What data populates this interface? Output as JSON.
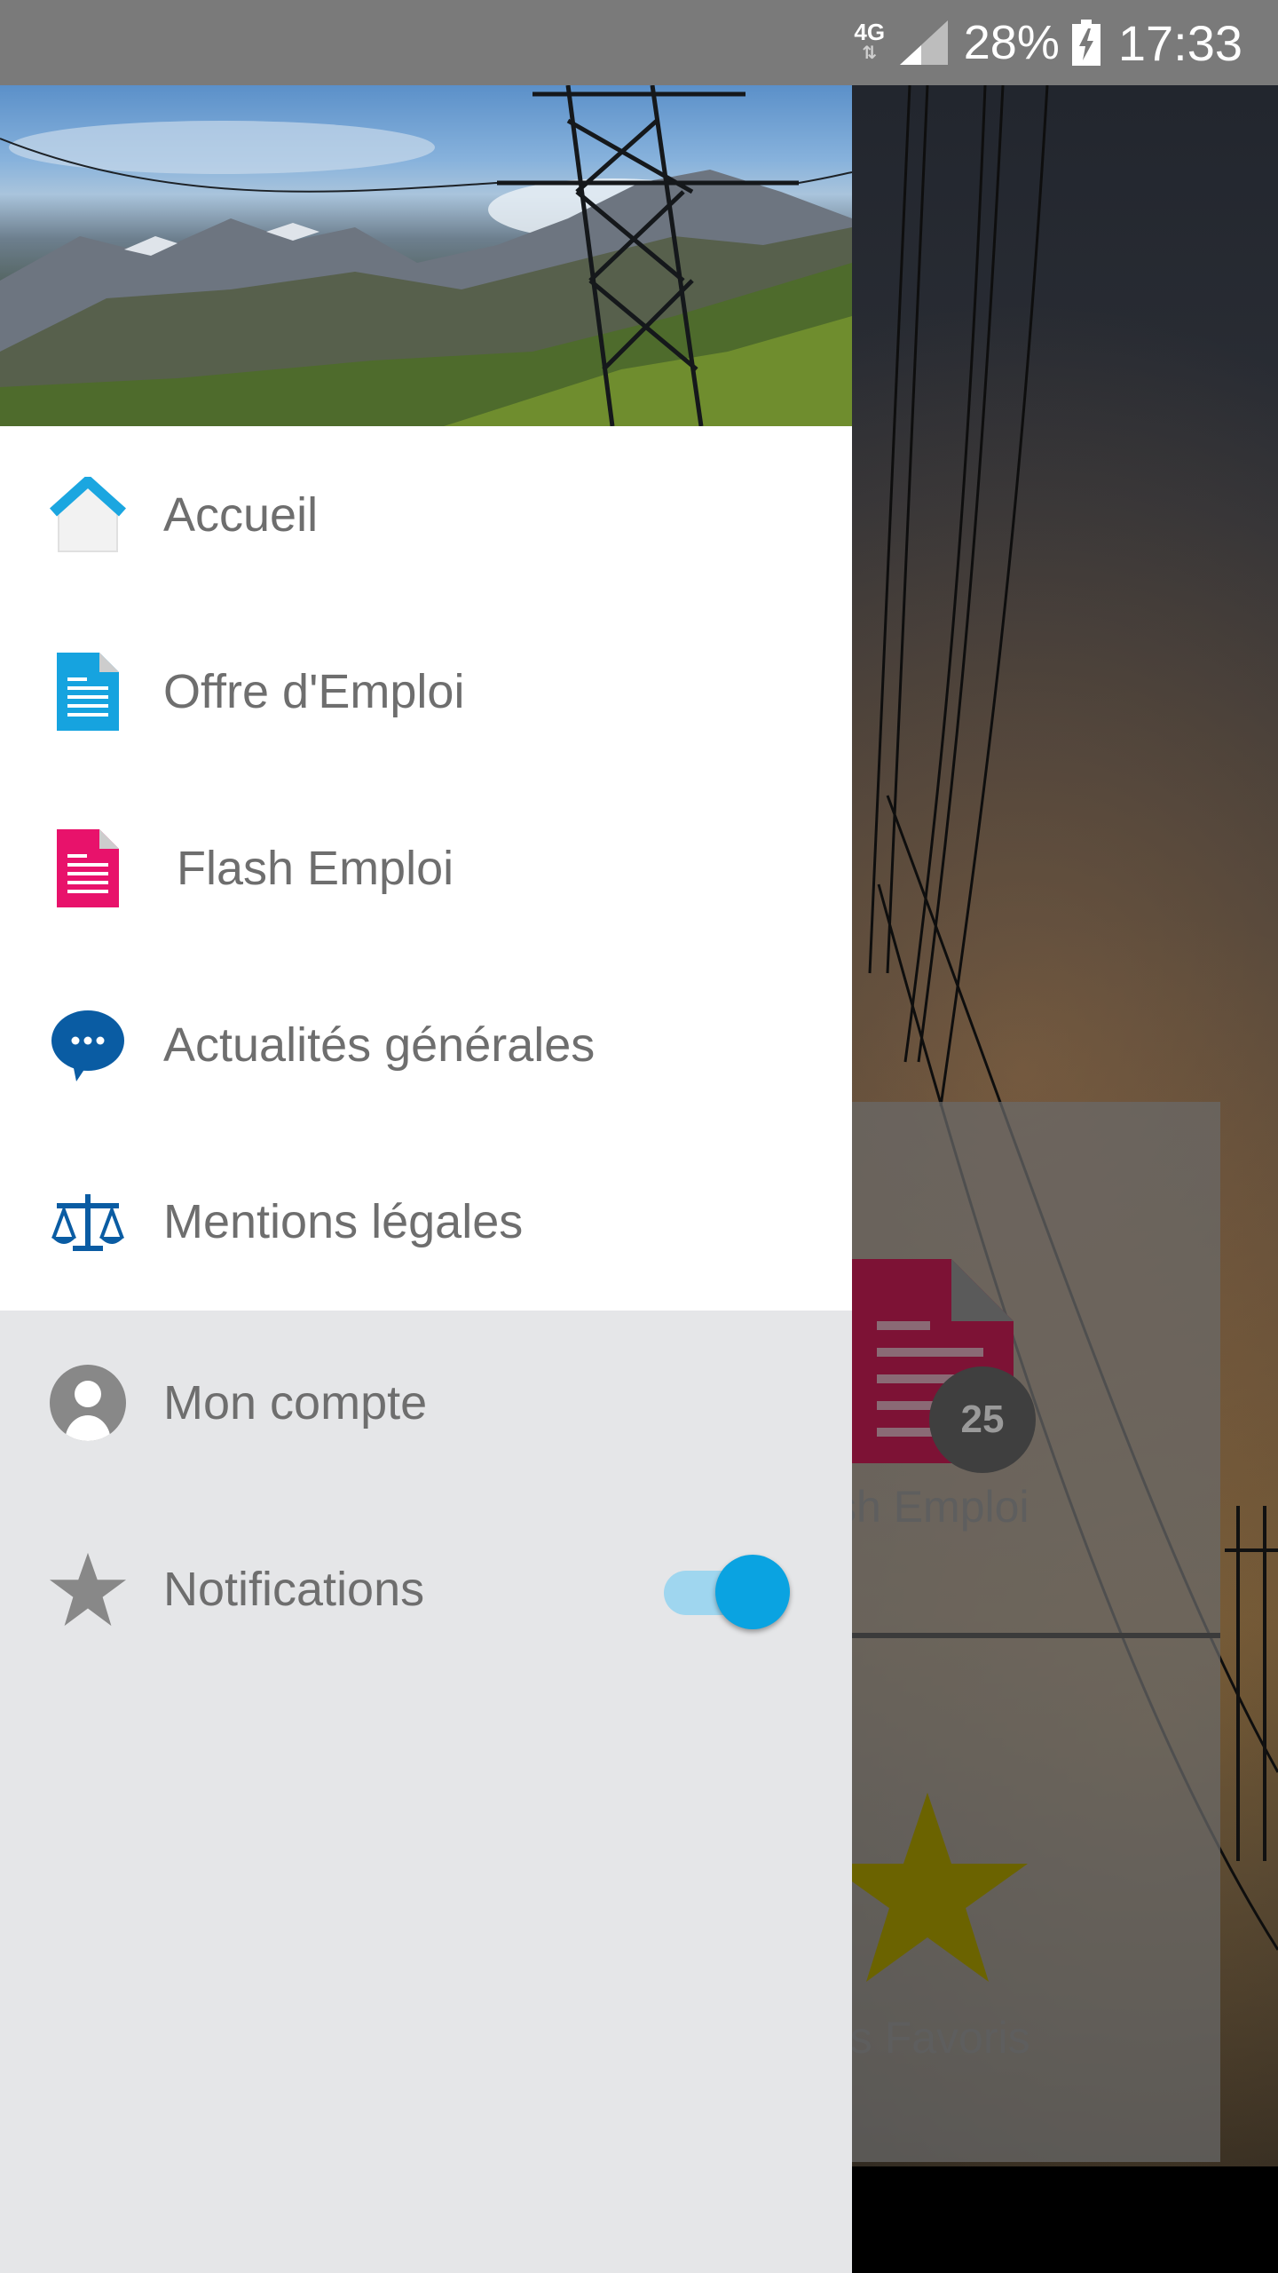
{
  "status_bar": {
    "network": "4G",
    "network_arrows": "⇅",
    "battery_percent": "28%",
    "time": "17:33",
    "icons": [
      "network-4g-icon",
      "signal-icon",
      "battery-charging-icon"
    ]
  },
  "drawer": {
    "menu_items": [
      {
        "label": "Accueil",
        "icon": "home-icon",
        "icon_color": "#1ba6e0"
      },
      {
        "label": "Offre d'Emploi",
        "icon": "document-icon",
        "icon_color": "#16a3df"
      },
      {
        "label": " Flash Emploi",
        "icon": "document-icon",
        "icon_color": "#e8126b"
      },
      {
        "label": "Actualités générales",
        "icon": "chat-bubble-icon",
        "icon_color": "#0a5ca3"
      },
      {
        "label": "Mentions légales",
        "icon": "scales-icon",
        "icon_color": "#0a5ca3"
      }
    ],
    "secondary_items": [
      {
        "label": "Mon compte",
        "icon": "account-icon",
        "icon_color": "#888888"
      },
      {
        "label": "Notifications",
        "icon": "star-icon",
        "icon_color": "#888888",
        "toggle_on": true
      }
    ]
  },
  "background": {
    "card_1_label": "sh Emploi",
    "card_1_badge": "25",
    "card_2_label": "es Favoris",
    "colors": {
      "badge": "#3f3f3f",
      "doc": "#7d1235",
      "star": "#6b6300"
    }
  },
  "colors": {
    "status_bar": "#7a7a7a",
    "drawer_menu": "#ffffff",
    "drawer_secondary": "#e5e6e8",
    "label_text": "#6e6e6e",
    "toggle_accent": "#0aa3e1"
  }
}
